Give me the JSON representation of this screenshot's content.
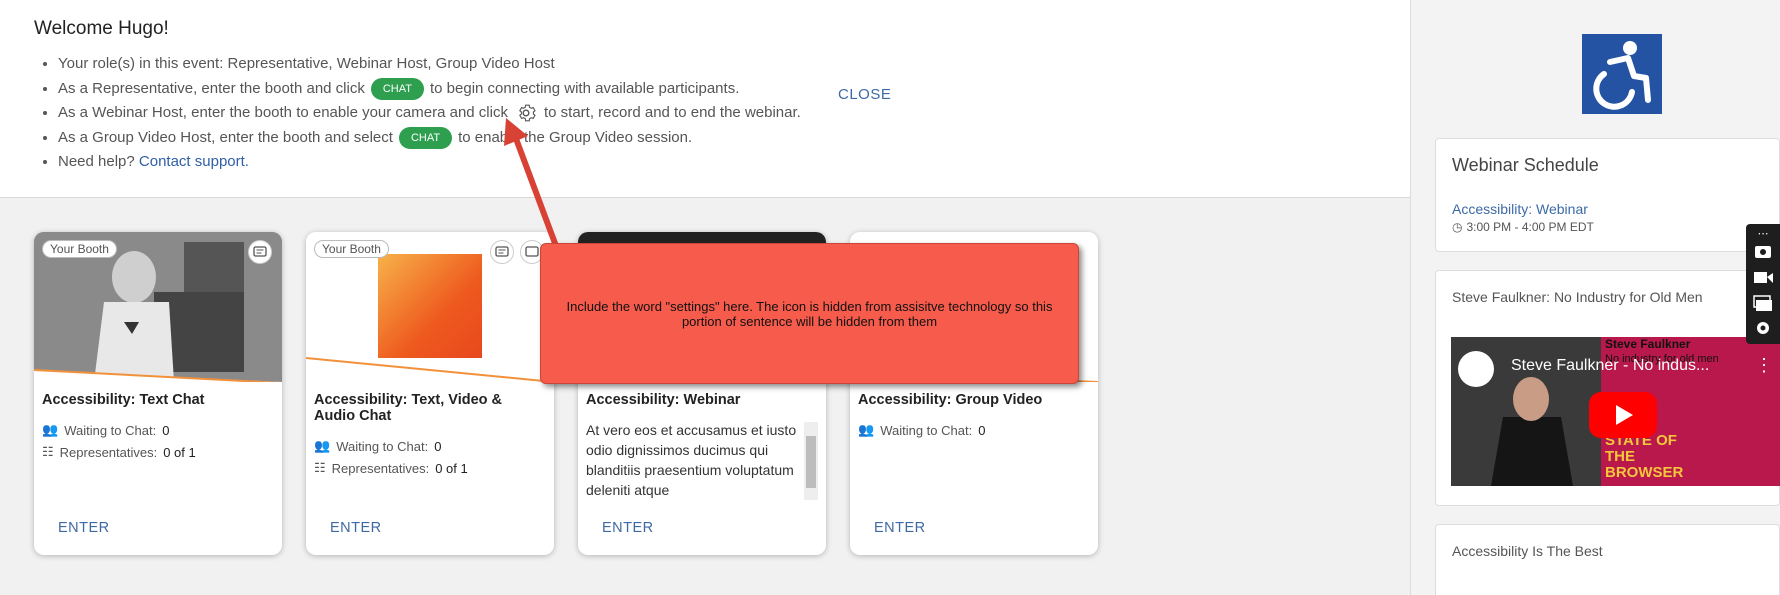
{
  "welcome": {
    "title": "Welcome Hugo!",
    "close_label": "CLOSE",
    "lines": {
      "roles": "Your role(s) in this event: Representative, Webinar Host, Group Video Host",
      "rep_before": "As a Representative, enter the booth and click",
      "rep_after": "to begin connecting with available participants.",
      "web_before": "As a Webinar Host, enter the booth to enable your camera and click",
      "web_after": "to start, record and to end the webinar.",
      "group_before": "As a Group Video Host, enter the booth and select",
      "group_after": "to enable the Group Video session.",
      "help_before": "Need help?",
      "help_link": "Contact support."
    },
    "chip_label": "CHAT"
  },
  "cards": [
    {
      "badge": "Your Booth",
      "title": "Accessibility: Text Chat",
      "waiting_label": "Waiting to Chat:",
      "waiting": "0",
      "reps_label": "Representatives:",
      "reps": "0 of 1",
      "enter": "ENTER"
    },
    {
      "badge": "Your Booth",
      "title": "Accessibility: Text, Video & Audio Chat",
      "waiting_label": "Waiting to Chat:",
      "waiting": "0",
      "reps_label": "Representatives:",
      "reps": "0 of 1",
      "enter": "ENTER"
    },
    {
      "title": "Accessibility: Webinar",
      "description": "At vero eos et accusamus et iusto odio dignissimos ducimus qui blanditiis praesentium voluptatum deleniti atque",
      "enter": "ENTER"
    },
    {
      "title": "Accessibility: Group Video",
      "waiting_label": "Waiting to Chat:",
      "waiting": "0",
      "enter": "ENTER"
    }
  ],
  "sidebar": {
    "schedule_title": "Webinar Schedule",
    "schedule_item": "Accessibility: Webinar",
    "schedule_time": "3:00 PM - 4:00 PM EDT",
    "video_panel_title": "Steve Faulkner: No Industry for Old Men",
    "video_title": "Steve Faulkner - No indus...",
    "video_poster_name": "Steve Faulkner",
    "video_poster_sub": "No industry for old men",
    "video_poster_event": "STATE OF THE BROWSER",
    "third_panel_title": "Accessibility Is The Best"
  },
  "annotation": {
    "text": "Include the word \"settings\" here. The icon is hidden from assisitve technology so this portion of sentence will be hidden from them"
  },
  "colors": {
    "chip_green": "#2e9e4f",
    "link_blue": "#3d6aa6",
    "callout_red": "#f65b4c",
    "accessibility_blue": "#2453a4"
  }
}
